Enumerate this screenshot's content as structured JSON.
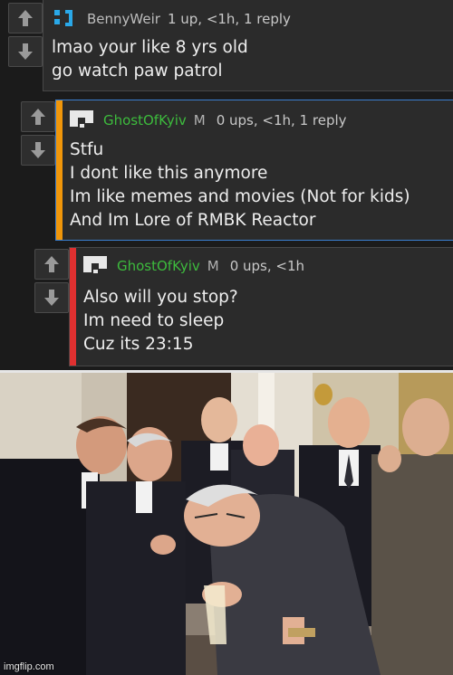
{
  "thread": {
    "comments": [
      {
        "username": "BennyWeir",
        "badge": "",
        "meta": "1 up, <1h, 1 reply",
        "lines": [
          "lmao your like 8 yrs old",
          "go watch paw patrol"
        ],
        "username_color": "#bdbdbd",
        "accent_color": ""
      },
      {
        "username": "GhostOfKyiv",
        "badge": "M",
        "meta": "0 ups, <1h, 1 reply",
        "lines": [
          "Stfu",
          "I dont like this anymore",
          "Im like memes and movies (Not for kids)",
          "And Im Lore of RMBK Reactor"
        ],
        "username_color": "#3dbb3d",
        "accent_color": "#f0960a"
      },
      {
        "username": "GhostOfKyiv",
        "badge": "M",
        "meta": "0 ups, <1h",
        "lines": [
          "Also will you stop?",
          "Im need to sleep",
          "Cuz its 23:15"
        ],
        "username_color": "#3dbb3d",
        "accent_color": "#e03030"
      }
    ],
    "icons": {
      "upvote": "arrow-up-icon",
      "downvote": "arrow-down-icon"
    },
    "thread_line_color": "#3b7fd0"
  },
  "meme": {
    "template": "laughing-men-in-suits",
    "watermark": "imgflip.com"
  }
}
